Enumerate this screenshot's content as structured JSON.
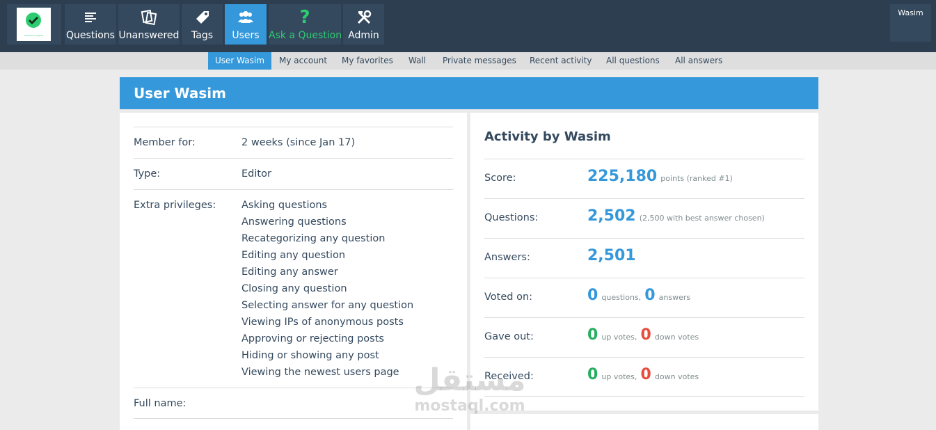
{
  "header": {
    "logo_text": "Insurance support",
    "nav": [
      {
        "label": "Questions",
        "icon": "list-icon"
      },
      {
        "label": "Unanswered",
        "icon": "unanswered-icon"
      },
      {
        "label": "Tags",
        "icon": "tag-icon"
      },
      {
        "label": "Users",
        "icon": "users-icon"
      },
      {
        "label": "Ask a Question",
        "icon": "question-mark-icon"
      },
      {
        "label": "Admin",
        "icon": "tools-icon"
      }
    ],
    "user": "Wasim"
  },
  "subnav": [
    "User Wasim",
    "My account",
    "My favorites",
    "Wall",
    "Private messages",
    "Recent activity",
    "All questions",
    "All answers"
  ],
  "page_title": "User Wasim",
  "profile": {
    "member_label": "Member for:",
    "member_value": "2 weeks (since Jan 17)",
    "type_label": "Type:",
    "type_value": "Editor",
    "priv_label": "Extra privileges:",
    "privileges": [
      "Asking questions",
      "Answering questions",
      "Recategorizing any question",
      "Editing any question",
      "Editing any answer",
      "Closing any question",
      "Selecting answer for any question",
      "Viewing IPs of anonymous posts",
      "Approving or rejecting posts",
      "Hiding or showing any post",
      "Viewing the newest users page"
    ],
    "fullname_label": "Full name:"
  },
  "activity": {
    "title": "Activity by Wasim",
    "score_label": "Score:",
    "score_value": "225,180",
    "score_note": "points (ranked #1)",
    "questions_label": "Questions:",
    "questions_value": "2,502",
    "questions_note": "(2,500 with best answer chosen)",
    "answers_label": "Answers:",
    "answers_value": "2,501",
    "voted_label": "Voted on:",
    "voted_q": "0",
    "voted_q_note": "questions,",
    "voted_a": "0",
    "voted_a_note": "answers",
    "gave_label": "Gave out:",
    "gave_up": "0",
    "gave_up_note": "up votes,",
    "gave_down": "0",
    "gave_down_note": "down votes",
    "recv_label": "Received:",
    "recv_up": "0",
    "recv_up_note": "up votes,",
    "recv_down": "0",
    "recv_down_note": "down votes"
  },
  "watermark": {
    "arabic": "مستقل",
    "latin": "mostaql.com"
  },
  "colors": {
    "topbar": "#2c3e50",
    "nav_bg": "#34495e",
    "accent": "#3498db",
    "green": "#27ae60",
    "red": "#e74c3c"
  }
}
